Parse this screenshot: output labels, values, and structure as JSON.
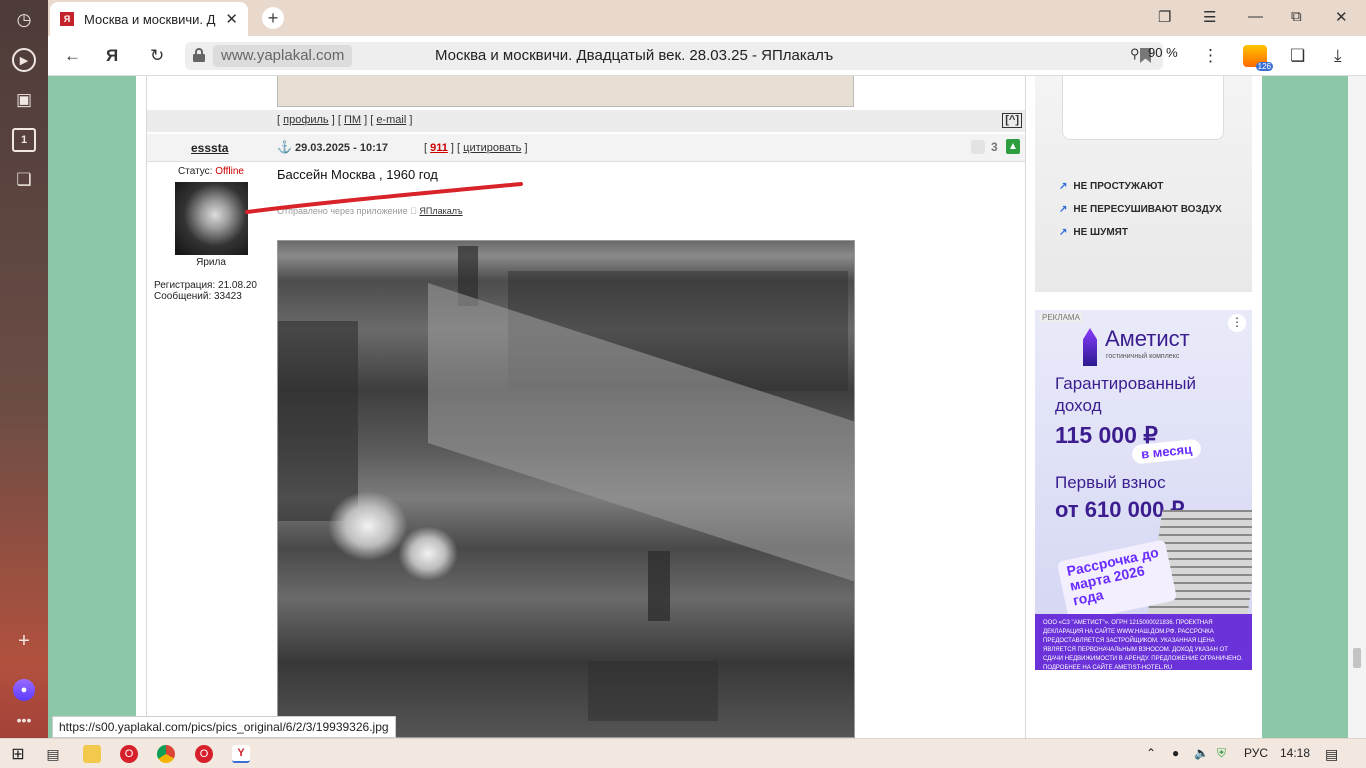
{
  "browser": {
    "tab_title": "Москва и москвичи. Д",
    "tab_favicon_text": "Я",
    "url_domain": "www.yaplakal.com",
    "page_title": "Москва и москвичи. Двадцатый век. 28.03.25 - ЯПлакалъ",
    "zoom": "90 %",
    "extension_badge": "126",
    "status_url": "https://s00.yaplakal.com/pics/pics_original/6/2/3/19939326.jpg"
  },
  "sidebar": {
    "items": [
      "history-icon",
      "play-icon",
      "camera-icon",
      "tab-one-icon",
      "collections-icon"
    ],
    "tab_one_label": "1"
  },
  "post": {
    "links": {
      "profile": "профиль",
      "pm": "ПМ",
      "email": "e-mail",
      "up": "[^]"
    },
    "author": "esssta",
    "date": "29.03.2025 - 10:17",
    "post_number": "911",
    "quote_label": "цитировать",
    "rating": "3",
    "status_label": "Статус:",
    "status_value": "Offline",
    "nick": "Ярила",
    "registration": "Регистрация: 21.08.20",
    "messages": "Сообщений: 33423",
    "text": "Бассейн Москва , 1960 год",
    "via_prefix": "Отправлено через приложение",
    "via_app": "ЯПлакалъ"
  },
  "ads": {
    "ac_features": [
      "НЕ ПРОСТУЖАЮТ",
      "НЕ ПЕРЕСУШИВАЮТ ВОЗДУХ",
      "НЕ ШУМЯТ"
    ],
    "ad_label": "РЕКЛАМА",
    "brand": "Аметист",
    "brand_sub": "гостиничный комплекс",
    "headline": "Гарантированный доход",
    "amount": "115 000 ₽",
    "per_month": "в месяц",
    "first_payment_label": "Первый взнос",
    "first_payment": "от 610 000 ₽",
    "installment": "Рассрочка до марта 2026 года",
    "legal": "ООО «СЗ \"АМЕТИСТ\"». ОГРН 1215000021836. ПРОЕКТНАЯ ДЕКЛАРАЦИЯ НА САЙТЕ WWW.НАШ.ДОМ.РФ. РАССРОЧКА ПРЕДОСТАВЛЯЕТСЯ ЗАСТРОЙЩИКОМ. УКАЗАННАЯ ЦЕНА ЯВЛЯЕТСЯ ПЕРВОНАЧАЛЬНЫМ ВЗНОСОМ. ДОХОД УКАЗАН ОТ СДАЧИ НЕДВИЖИМОСТИ В АРЕНДУ. ПРЕДЛОЖЕНИЕ ОГРАНИЧЕНО. ПОДРОБНЕЕ НА САЙТЕ AMETIST-HOTEL.RU"
  },
  "taskbar": {
    "language": "РУС",
    "time": "14:18"
  }
}
